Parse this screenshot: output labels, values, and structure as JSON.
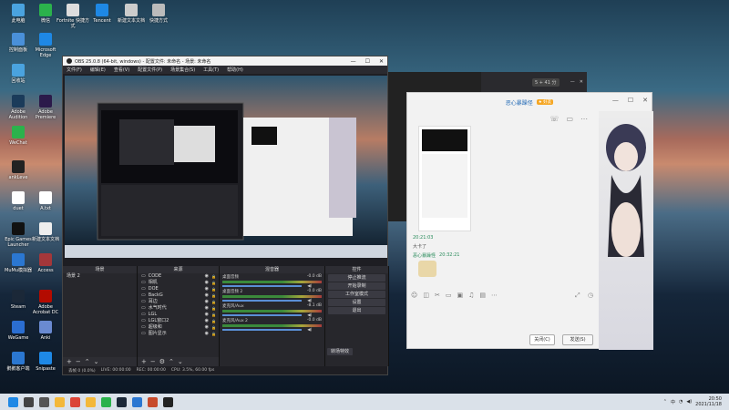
{
  "desktop": {
    "icons": [
      {
        "label": "此电脑",
        "color": "#4aa3df"
      },
      {
        "label": "微信",
        "color": "#2bb24c"
      },
      {
        "label": "Fortnite 快捷方式",
        "color": "#ddd"
      },
      {
        "label": "Tencent",
        "color": "#1e88e5"
      },
      {
        "label": "新建文本文档",
        "color": "#ccc"
      },
      {
        "label": "快捷方式",
        "color": "#bbb"
      },
      {
        "label": "控制面板",
        "color": "#4a90d9"
      },
      {
        "label": "Microsoft Edge",
        "color": "#1e88e5"
      },
      {
        "label": "回收站",
        "color": "#4aa3df"
      },
      {
        "label": "Adobe Audition",
        "color": "#1b3b5a"
      },
      {
        "label": "Adobe Premiere",
        "color": "#2b1a4a"
      },
      {
        "label": "WeChat",
        "color": "#2bb24c"
      },
      {
        "label": "ankLeve",
        "color": "#222"
      },
      {
        "label": "duet",
        "color": "#fff"
      },
      {
        "label": "A.txt",
        "color": "#fff"
      },
      {
        "label": "Epic Games Launcher",
        "color": "#111"
      },
      {
        "label": "新建文本文档",
        "color": "#eee"
      },
      {
        "label": "MuMu模拟器",
        "color": "#2b77d1"
      },
      {
        "label": "Access",
        "color": "#a4373a"
      },
      {
        "label": "Steam",
        "color": "#1b2838"
      },
      {
        "label": "Adobe Acrobat DC",
        "color": "#b30b00"
      },
      {
        "label": "WeGame",
        "color": "#2b6ed1"
      },
      {
        "label": "Anki",
        "color": "#6a8ad1"
      },
      {
        "label": "鹅鹅客户端",
        "color": "#2b77d1"
      },
      {
        "label": "Snipaste",
        "color": "#1e88e5"
      }
    ]
  },
  "obs": {
    "title": "OBS 25.0.8 (64-bit, windows) - 配置文件: 未命名 - 场景: 未命名",
    "menu": [
      "文件(F)",
      "编辑(E)",
      "查看(V)",
      "配置文件(P)",
      "场景集合(S)",
      "工具(T)",
      "帮助(H)"
    ],
    "scenes_header": "场景",
    "scenes": [
      "场景 2"
    ],
    "sources_header": "来源",
    "sources": [
      "CODE",
      "相机",
      "DOE",
      "BackG",
      "耳边",
      "水气时代",
      "LGL",
      "LGL窗口2",
      "超级和",
      "图片显示"
    ],
    "mixer_header": "混音器",
    "mixer": [
      {
        "name": "桌面音频",
        "db": "-0.0 dB"
      },
      {
        "name": "桌面音频 2",
        "db": "-0.0 dB"
      },
      {
        "name": "麦克风/Aux",
        "db": "-8.1 dB"
      },
      {
        "name": "麦克风/Aux 2",
        "db": "-0.0 dB"
      }
    ],
    "transitions_header": "转场特效",
    "controls_header": "控件",
    "controls": [
      "停止推流",
      "开始录制",
      "工作室模式",
      "设置",
      "退出"
    ],
    "status": {
      "dropped": "丢帧 0 (0.0%)",
      "live": "LIVE: 00:00:00",
      "rec": "REC: 00:00:00",
      "cpu": "CPU: 3.5%, 60.00 fps"
    },
    "window_buttons": [
      "—",
      "☐",
      "✕"
    ]
  },
  "chat": {
    "contact": "恶心暴躁怪",
    "tag": "★ 好友",
    "messages": [
      {
        "time": "20:21:03",
        "sender": "",
        "text": "大卡了"
      },
      {
        "time": "20:32:21",
        "sender": "恶心暴躁怪",
        "text": ""
      }
    ],
    "close_label": "关闭(C)",
    "send_label": "发送(S)",
    "window_buttons": [
      "—",
      "☐",
      "✕"
    ]
  },
  "background_app": {
    "status_text": "5 + 41 分"
  },
  "taskbar": {
    "time": "20:50",
    "date": "2021/11/18",
    "lang": "中"
  }
}
